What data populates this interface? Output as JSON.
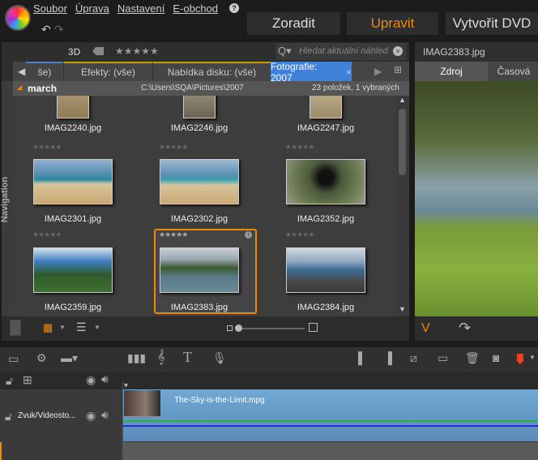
{
  "menu": [
    "Soubor",
    "Úprava",
    "Nastavení",
    "E-obchod"
  ],
  "help_icon": "?",
  "top_buttons": {
    "organize": "Zoradit",
    "edit": "Upravit",
    "dvd": "Vytvořit DVD"
  },
  "accent": "#f08a00",
  "library": {
    "toolbar": {
      "label_3d": "3D",
      "stars": "★★★★★",
      "search_placeholder": "Hledat aktuální náhled"
    },
    "tabs": [
      {
        "label": "še)"
      },
      {
        "label": "Efekty: (vše)"
      },
      {
        "label": "Nabídka disku: (vše)"
      },
      {
        "label": "Fotografie: 2007",
        "active": true
      }
    ],
    "folder": "march",
    "path": "C:\\Users\\SQA\\Pictures\\2007",
    "count": "23 položek, 1 vybraných",
    "nav_label": "Navigation",
    "items": [
      {
        "name": "IMAG2240.jpg"
      },
      {
        "name": "IMAG2246.jpg"
      },
      {
        "name": "IMAG2247.jpg"
      },
      {
        "name": "IMAG2301.jpg"
      },
      {
        "name": "IMAG2302.jpg"
      },
      {
        "name": "IMAG2352.jpg"
      },
      {
        "name": "IMAG2359.jpg"
      },
      {
        "name": "IMAG2383.jpg",
        "selected": true
      },
      {
        "name": "IMAG2384.jpg"
      }
    ],
    "rating_stars": "★★★★★"
  },
  "preview": {
    "title": "IMAG2383.jpg",
    "tabs": [
      "Zdroj",
      "Časová"
    ],
    "v_label": "V"
  },
  "timeline": {
    "track_name": "Zvuk/Videosto...",
    "clip_name": "The-Sky-is-the-Limit.mpg"
  }
}
